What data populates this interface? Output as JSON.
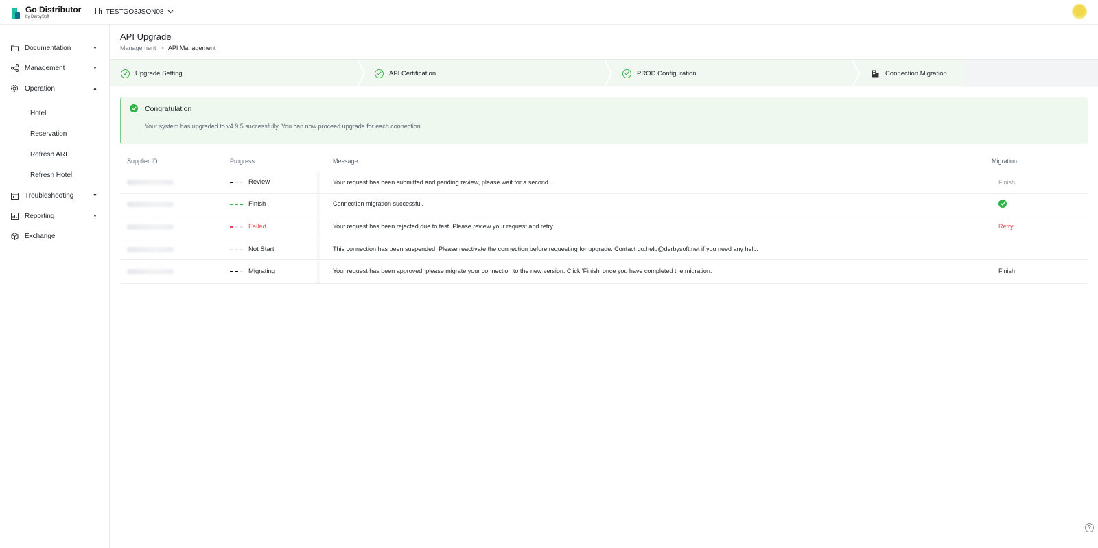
{
  "app": {
    "name": "Go Distributor",
    "by": "by DerbySoft",
    "tenant": "TESTGO3JSON08"
  },
  "sidebar": {
    "items": [
      {
        "label": "Documentation",
        "icon": "folder-icon",
        "expanded": false
      },
      {
        "label": "Management",
        "icon": "share-icon",
        "expanded": false
      },
      {
        "label": "Operation",
        "icon": "gear-icon",
        "expanded": true
      },
      {
        "label": "Troubleshooting",
        "icon": "calendar-icon",
        "expanded": false
      },
      {
        "label": "Reporting",
        "icon": "chart-icon",
        "expanded": false
      },
      {
        "label": "Exchange",
        "icon": "cube-icon",
        "expanded": false
      }
    ],
    "operation_children": [
      "Hotel",
      "Reservation",
      "Refresh ARI",
      "Refresh Hotel"
    ]
  },
  "page": {
    "title": "API Upgrade",
    "breadcrumb": [
      "Management",
      ">",
      "API Management"
    ]
  },
  "steps": [
    {
      "label": "Upgrade Setting",
      "status": "done"
    },
    {
      "label": "API Certification",
      "status": "done"
    },
    {
      "label": "PROD Configuration",
      "status": "done"
    },
    {
      "label": "Connection Migration",
      "status": "current"
    }
  ],
  "alert": {
    "title": "Congratulation",
    "message": "Your system has upgraded to v4.9.5 successfully. You can now proceed upgrade for each connection."
  },
  "table": {
    "headers": [
      "Supplier ID",
      "Progress",
      "Message",
      "Migration"
    ],
    "rows": [
      {
        "progress": "Review",
        "filled": 1,
        "color": "#111111",
        "message": "Your request has been submitted and pending review, please wait for a second.",
        "migration": "Finish",
        "migration_style": "muted"
      },
      {
        "progress": "Finish",
        "filled": 3,
        "color": "#2fb344",
        "message": "Connection migration successful.",
        "migration": "",
        "migration_style": "check"
      },
      {
        "progress": "Failed",
        "filled": 1,
        "color": "#e5484d",
        "message": "Your request has been rejected due to test. Please review your request and retry",
        "migration": "Retry",
        "migration_style": "danger"
      },
      {
        "progress": "Not Start",
        "filled": 0,
        "color": "#d7dadf",
        "message": "This connection has been suspended. Please reactivate the connection before requesting for upgrade. Contact go.help@derbysoft.net if you need any help.",
        "migration": "",
        "migration_style": "none"
      },
      {
        "progress": "Migrating",
        "filled": 2,
        "color": "#111111",
        "message": "Your request has been approved, please migrate your connection to the new version. Click 'Finish' once you have completed the migration.",
        "migration": "Finish",
        "migration_style": "normal"
      }
    ]
  },
  "colors": {
    "accent": "#2fb344",
    "danger": "#e5484d",
    "muted": "#9aa0a6"
  }
}
